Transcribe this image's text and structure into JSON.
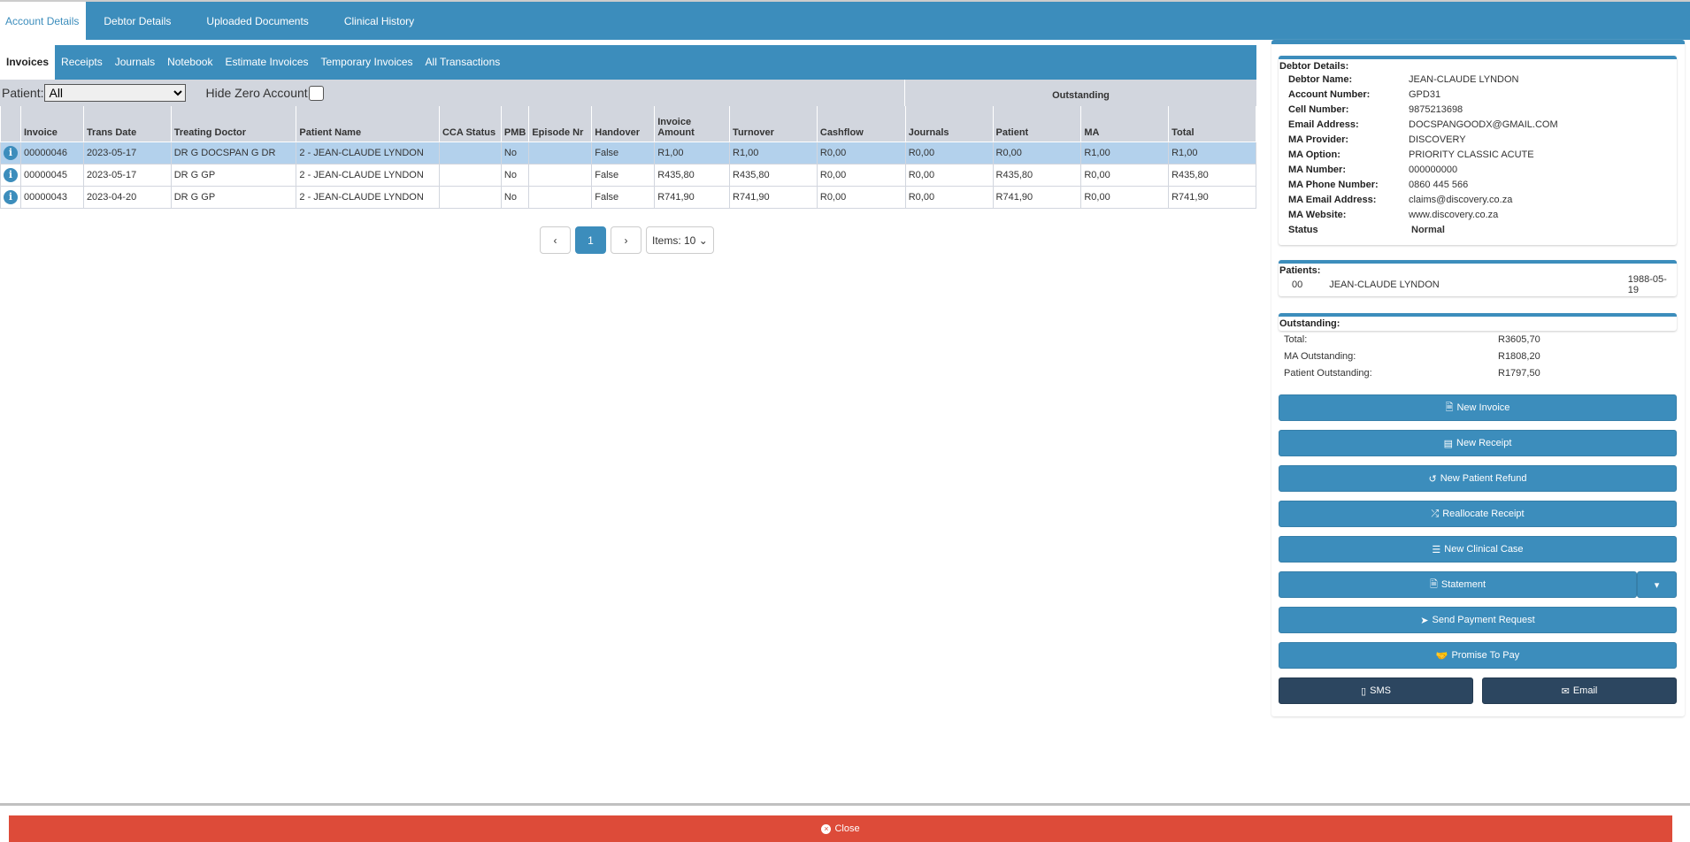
{
  "top_tabs": [
    "Account Details",
    "Debtor Details",
    "Uploaded Documents",
    "Clinical History"
  ],
  "sub_tabs": [
    "Invoices",
    "Receipts",
    "Journals",
    "Notebook",
    "Estimate Invoices",
    "Temporary Invoices",
    "All Transactions"
  ],
  "filter": {
    "patient_label": "Patient:",
    "patient_value": "All",
    "hide_zero_label": "Hide Zero Account",
    "outstanding_label": "Outstanding"
  },
  "columns": [
    "Invoice",
    "Trans Date",
    "Treating Doctor",
    "Patient Name",
    "CCA Status",
    "PMB",
    "Episode Nr",
    "Handover",
    "Invoice Amount",
    "Turnover",
    "Cashflow",
    "Journals",
    "Patient",
    "MA",
    "Total"
  ],
  "rows": [
    [
      "00000046",
      "2023-05-17",
      "DR G DOCSPAN G DR",
      "2 - JEAN-CLAUDE LYNDON",
      "",
      "No",
      "",
      "False",
      "R1,00",
      "R1,00",
      "R0,00",
      "R0,00",
      "R0,00",
      "R1,00",
      "R1,00"
    ],
    [
      "00000045",
      "2023-05-17",
      "DR G GP",
      "2 - JEAN-CLAUDE LYNDON",
      "",
      "No",
      "",
      "False",
      "R435,80",
      "R435,80",
      "R0,00",
      "R0,00",
      "R435,80",
      "R0,00",
      "R435,80"
    ],
    [
      "00000043",
      "2023-04-20",
      "DR G GP",
      "2 - JEAN-CLAUDE LYNDON",
      "",
      "No",
      "",
      "False",
      "R741,90",
      "R741,90",
      "R0,00",
      "R0,00",
      "R741,90",
      "R0,00",
      "R741,90"
    ]
  ],
  "pagination": {
    "prev": "‹",
    "page": "1",
    "next": "›",
    "items": "Items: 10"
  },
  "debtor": {
    "title": "Debtor Details:",
    "fields": [
      [
        "Debtor Name:",
        "JEAN-CLAUDE LYNDON"
      ],
      [
        "Account Number:",
        "GPD31"
      ],
      [
        "Cell Number:",
        "9875213698"
      ],
      [
        "Email Address:",
        "DOCSPANGOODX@GMAIL.COM"
      ],
      [
        "MA Provider:",
        "DISCOVERY"
      ],
      [
        "MA Option:",
        "PRIORITY CLASSIC ACUTE"
      ],
      [
        "MA Number:",
        "000000000"
      ],
      [
        "MA Phone Number:",
        "0860 445 566"
      ],
      [
        "MA Email Address:",
        "claims@discovery.co.za"
      ],
      [
        "MA Website:",
        "www.discovery.co.za"
      ],
      [
        "Status",
        "Normal"
      ]
    ]
  },
  "patients": {
    "title": "Patients:",
    "list": [
      [
        "00",
        "JEAN-CLAUDE LYNDON",
        "1988-05-19"
      ]
    ]
  },
  "outstanding": {
    "title": "Outstanding:",
    "fields": [
      [
        "Total:",
        "R3605,70"
      ],
      [
        "MA Outstanding:",
        "R1808,20"
      ],
      [
        "Patient Outstanding:",
        "R1797,50"
      ]
    ]
  },
  "buttons": [
    "New Invoice",
    "New Receipt",
    "New Patient Refund",
    "Reallocate Receipt",
    "New Clinical Case",
    "Statement",
    "Send Payment Request",
    "Promise To Pay"
  ],
  "sms": "SMS",
  "email": "Email",
  "close": "Close"
}
